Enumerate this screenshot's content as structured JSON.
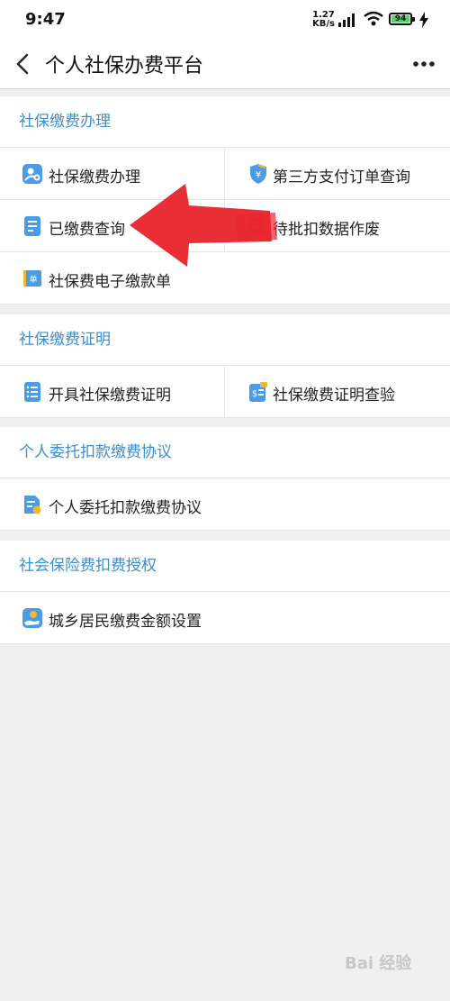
{
  "status": {
    "time": "9:47",
    "speed_top": "1.27",
    "speed_bottom": "KB/s",
    "battery": "94"
  },
  "navbar": {
    "title": "个人社保办费平台"
  },
  "sections": [
    {
      "title": "社保缴费办理",
      "items": [
        {
          "label": "社保缴费办理",
          "icon": "person-pay-icon"
        },
        {
          "label": "第三方支付订单查询",
          "icon": "shield-yuan-icon"
        },
        {
          "label": "已缴费查询",
          "icon": "document-list-icon"
        },
        {
          "label": "待批扣数据作废",
          "icon": "database-discard-icon"
        },
        {
          "label": "社保费电子缴款单",
          "icon": "ticket-icon"
        }
      ]
    },
    {
      "title": "社保缴费证明",
      "items": [
        {
          "label": "开具社保缴费证明",
          "icon": "certificate-list-icon"
        },
        {
          "label": "社保缴费证明查验",
          "icon": "certificate-verify-icon"
        }
      ]
    },
    {
      "title": "个人委托扣款缴费协议",
      "items": [
        {
          "label": "个人委托扣款缴费协议",
          "icon": "agreement-icon"
        }
      ]
    },
    {
      "title": "社会保险费扣费授权",
      "items": [
        {
          "label": "城乡居民缴费金额设置",
          "icon": "hand-coin-icon"
        }
      ]
    }
  ],
  "watermark": "Bai 经验",
  "colors": {
    "accent": "#3a8fd0",
    "icon_blue": "#4a9ce6",
    "arrow_red": "#e8262d"
  }
}
